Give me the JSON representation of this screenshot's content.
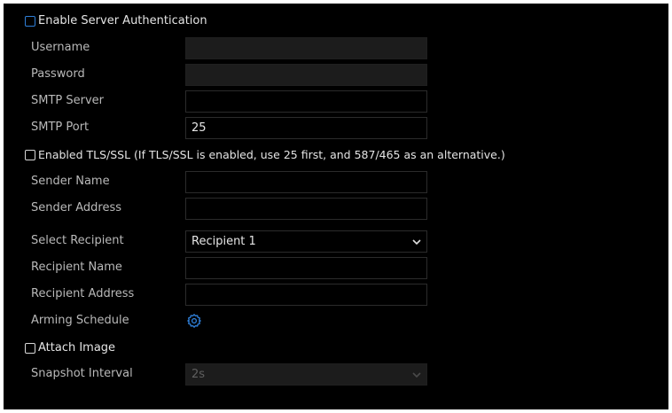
{
  "server_auth": {
    "label": "Enable Server Authentication"
  },
  "username": {
    "label": "Username",
    "value": ""
  },
  "password": {
    "label": "Password",
    "value": ""
  },
  "smtp_server": {
    "label": "SMTP Server",
    "value": ""
  },
  "smtp_port": {
    "label": "SMTP Port",
    "value": "25"
  },
  "tls": {
    "label": "Enabled TLS/SSL (If TLS/SSL is enabled, use 25 first, and 587/465 as an alternative.)"
  },
  "sender_name": {
    "label": "Sender Name",
    "value": ""
  },
  "sender_address": {
    "label": "Sender Address",
    "value": ""
  },
  "select_recipient": {
    "label": "Select Recipient",
    "value": "Recipient 1"
  },
  "recipient_name": {
    "label": "Recipient Name",
    "value": ""
  },
  "recipient_address": {
    "label": "Recipient Address",
    "value": ""
  },
  "arming_schedule": {
    "label": "Arming Schedule",
    "icon": "gear-icon"
  },
  "attach_image": {
    "label": "Attach Image"
  },
  "snapshot_interval": {
    "label": "Snapshot Interval",
    "value": "2s"
  },
  "colors": {
    "accent": "#2f7fd8",
    "background": "#000000",
    "label_text": "#b9b9b9"
  }
}
